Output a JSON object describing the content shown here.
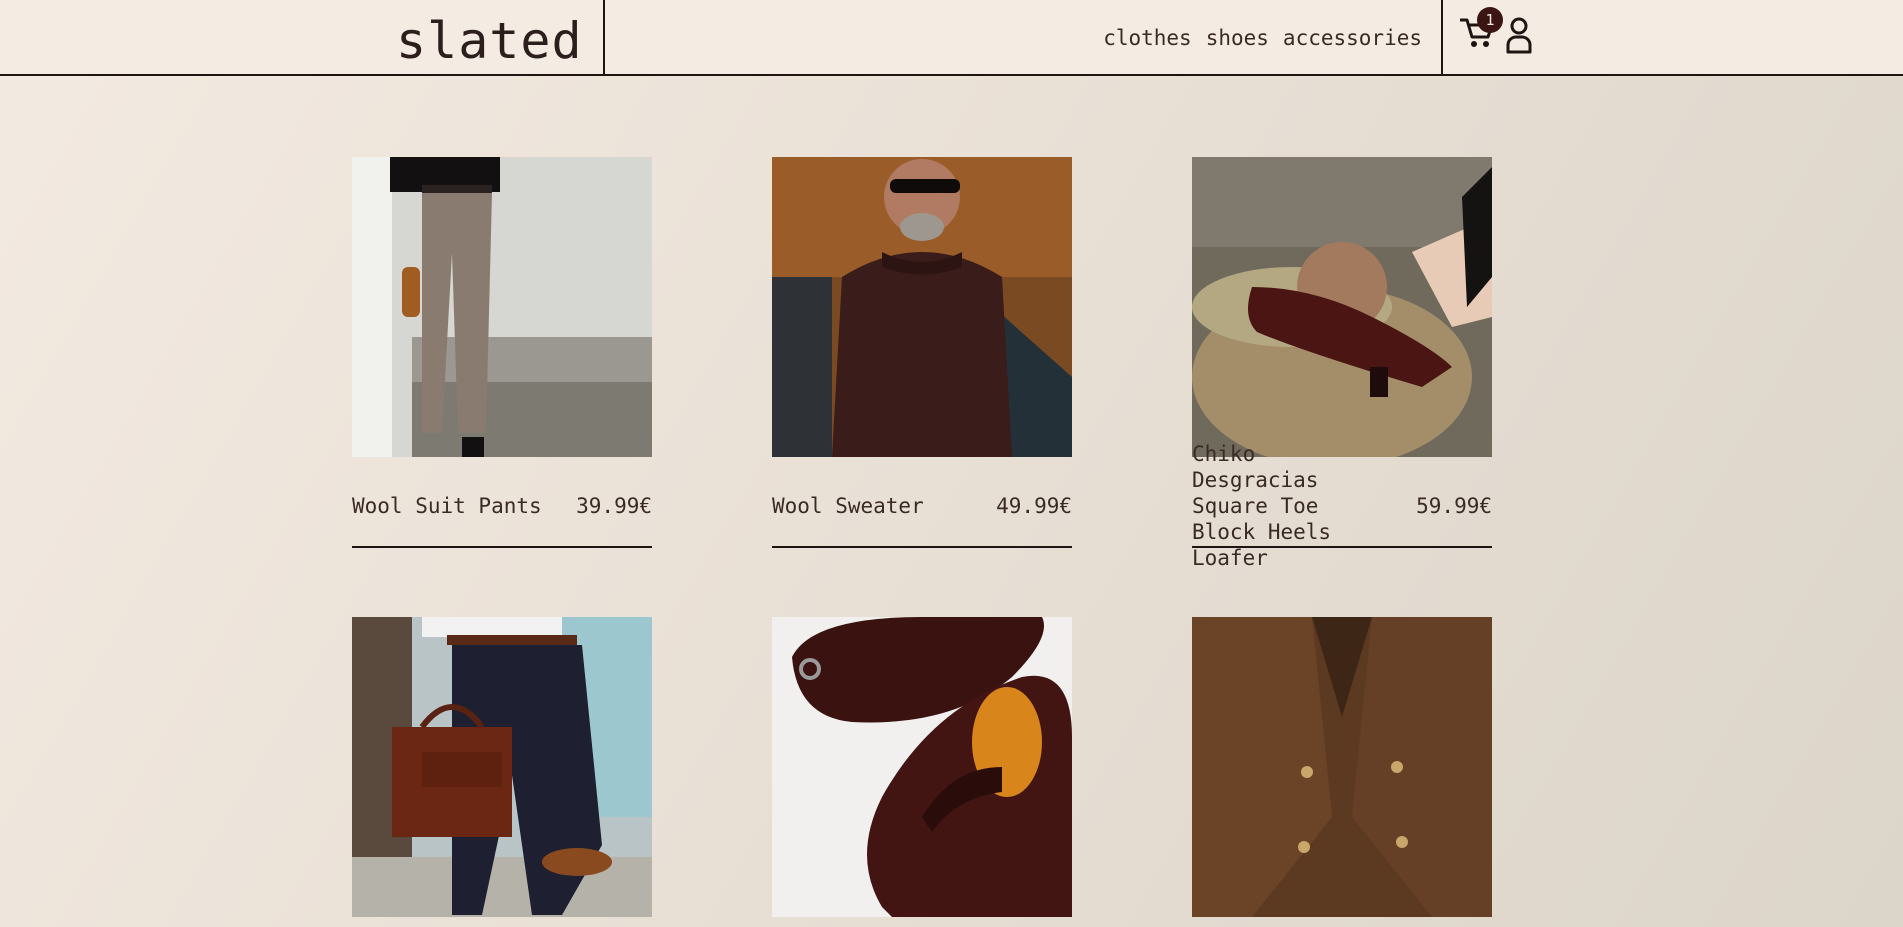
{
  "header": {
    "logo": "slated",
    "nav": [
      "clothes",
      "shoes",
      "accessories"
    ],
    "cart_count": "1"
  },
  "products": [
    {
      "name": "Wool Suit Pants",
      "price": "39.99€",
      "image": "pants-photo"
    },
    {
      "name": "Wool Sweater",
      "price": "49.99€",
      "image": "sweater-photo"
    },
    {
      "name": "Chiko Desgracias Square Toe Block Heels Loafer",
      "price": "59.99€",
      "image": "loafer-heel-photo"
    },
    {
      "name": "",
      "price": "",
      "image": "bag-trousers-photo"
    },
    {
      "name": "",
      "price": "",
      "image": "penny-loafer-photo"
    },
    {
      "name": "",
      "price": "",
      "image": "corduroy-blazer-photo"
    }
  ],
  "colors": {
    "ink": "#1f1412",
    "badge": "#3b1512",
    "background": "#ece3d9"
  }
}
